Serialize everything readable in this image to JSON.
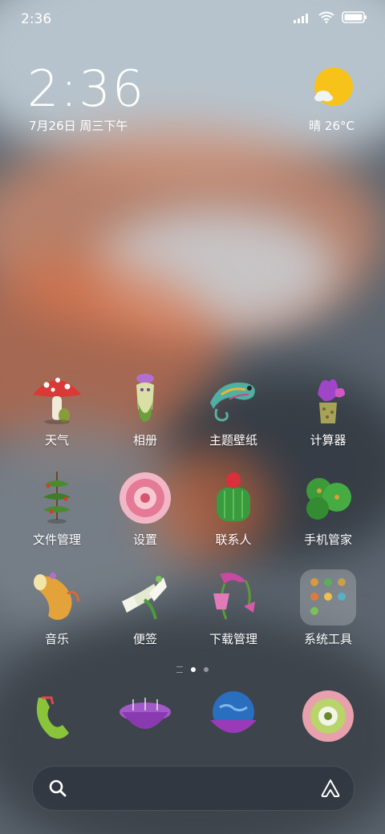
{
  "statusbar": {
    "time": "2:36",
    "battery_icon": "battery-icon",
    "wifi_icon": "wifi-icon",
    "signal_icon": "signal-icon"
  },
  "clock": {
    "time": "2:36",
    "date": "7月26日 周三下午"
  },
  "weather": {
    "icon": "sun-cloud-icon",
    "text": "晴 26°C"
  },
  "apps": [
    {
      "label": "天气",
      "icon": "mushroom-icon"
    },
    {
      "label": "相册",
      "icon": "pitcher-plant-icon"
    },
    {
      "label": "主题壁纸",
      "icon": "chameleon-icon"
    },
    {
      "label": "计算器",
      "icon": "purple-flower-icon"
    },
    {
      "label": "文件管理",
      "icon": "vine-tower-icon"
    },
    {
      "label": "设置",
      "icon": "pink-coral-icon"
    },
    {
      "label": "联系人",
      "icon": "cactus-strawberry-icon"
    },
    {
      "label": "手机管家",
      "icon": "green-cactus-cluster-icon"
    },
    {
      "label": "音乐",
      "icon": "horn-flower-icon"
    },
    {
      "label": "便签",
      "icon": "lily-bundle-icon"
    },
    {
      "label": "下载管理",
      "icon": "pink-bellflower-icon"
    },
    {
      "label": "系统工具",
      "icon": "folder-icon"
    }
  ],
  "page_indicator": {
    "pages": 2,
    "current": 1
  },
  "dock": [
    {
      "icon": "phone-sprout-icon"
    },
    {
      "icon": "purple-sphere-icon"
    },
    {
      "icon": "globe-bowl-icon"
    },
    {
      "icon": "flower-camera-icon"
    }
  ],
  "search": {
    "search_icon": "search-icon",
    "assistant_icon": "assistant-icon"
  }
}
